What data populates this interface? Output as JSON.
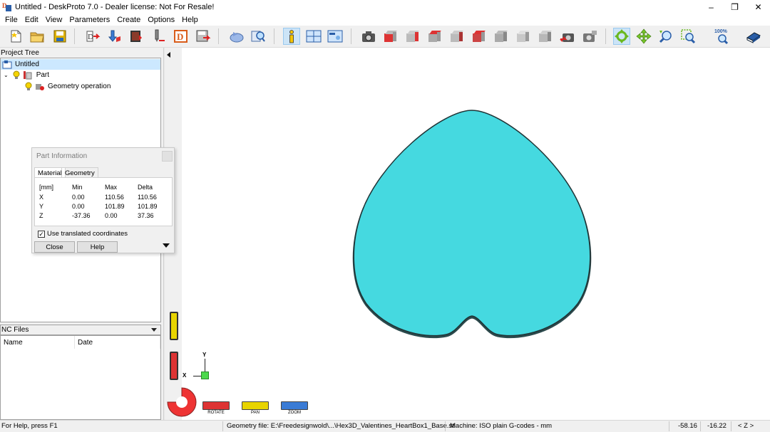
{
  "window": {
    "title": "Untitled - DeskProto 7.0 - Dealer license: Not For Resale!",
    "minimize": "–",
    "restore": "❐",
    "close": "✕"
  },
  "menu": [
    "File",
    "Edit",
    "View",
    "Parameters",
    "Create",
    "Options",
    "Help"
  ],
  "toolbar": {
    "zoom_percent": "100%"
  },
  "project_tree": {
    "label": "Project Tree",
    "items": [
      "Untitled",
      "Part",
      "Geometry operation"
    ]
  },
  "nc_files": {
    "label": "NC Files",
    "columns": [
      "Name",
      "Date"
    ]
  },
  "part_information": {
    "title": "Part Information",
    "tabs": [
      "Material",
      "Geometry"
    ],
    "header": [
      "[mm]",
      "Min",
      "Max",
      "Delta"
    ],
    "rows": [
      [
        "X",
        "0.00",
        "110.56",
        "110.56"
      ],
      [
        "Y",
        "0.00",
        "101.89",
        "101.89"
      ],
      [
        "Z",
        "-37.36",
        "0.00",
        "37.36"
      ]
    ],
    "checkbox_label": "Use translated coordinates",
    "checkbox_checked": true,
    "close_label": "Close",
    "help_label": "Help"
  },
  "viewport": {
    "axis_x": "X",
    "axis_y": "Y",
    "part_color": "#45d9e0",
    "modes": [
      "ROTATE",
      "PAN",
      "ZOOM"
    ]
  },
  "statusbar": {
    "help": "For Help, press F1",
    "geometry_file": "Geometry file: E:\\Freedesignwold\\...\\Hex3D_Valentines_HeartBox1_Base.stl",
    "machine": "Machine: ISO plain G-codes - mm",
    "coord_x": "-58.16",
    "coord_y": "-16.22",
    "axis_view": "< Z >"
  }
}
